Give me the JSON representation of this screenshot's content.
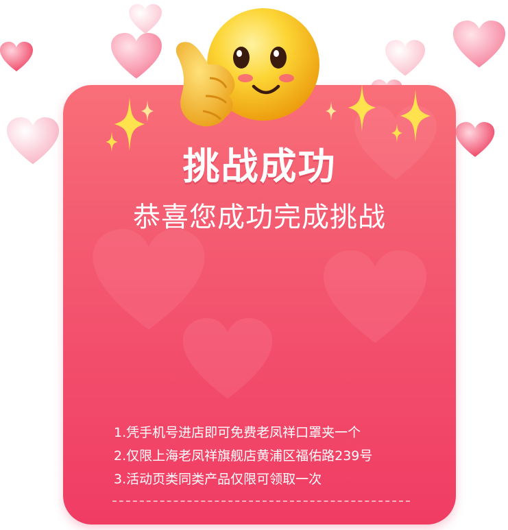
{
  "dialog": {
    "title": "挑战成功",
    "subtitle": "恭喜您成功完成挑战",
    "rules": [
      "1.凭手机号进店即可免费老凤祥口罩夹一个",
      "2.仅限上海老凤祥旗舰店黄浦区福佑路239号",
      "3.活动页类同类产品仅限可领取一次"
    ]
  },
  "decor": {
    "emoji_icon": "smiling-face-thumbs-up-icon",
    "heart_icon": "heart-icon",
    "sparkle_icon": "sparkle-star-icon"
  },
  "colors": {
    "card_top": "#f96f78",
    "card_bottom": "#f03c63",
    "heart_pink": "#ff8fa7",
    "emoji_yellow": "#f9c41c"
  }
}
